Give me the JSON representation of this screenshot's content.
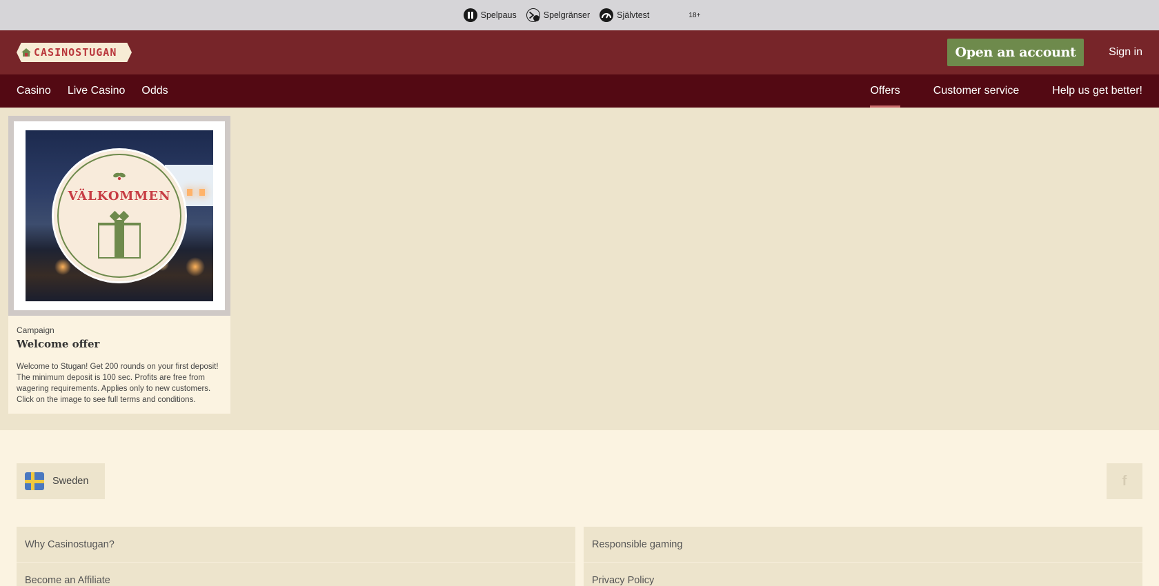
{
  "rg_bar": {
    "items": [
      {
        "label": "Spelpaus",
        "icon": "pause-icon"
      },
      {
        "label": "Spelgränser",
        "icon": "limit-gauge-icon"
      },
      {
        "label": "Självtest",
        "icon": "speedometer-icon"
      }
    ],
    "age": "18+"
  },
  "header": {
    "logo_text": "CASINOSTUGAN",
    "open_account": "Open an account",
    "sign_in": "Sign in"
  },
  "nav": {
    "left": [
      "Casino",
      "Live Casino",
      "Odds"
    ],
    "right": [
      "Offers",
      "Customer service",
      "Help us get better!"
    ],
    "active": "Offers"
  },
  "offer": {
    "badge_text": "VÄLKOMMEN",
    "tag": "Campaign",
    "title": "Welcome offer",
    "description": "Welcome to Stugan! Get 200 rounds on your first deposit! The minimum deposit is 100 sec. Profits are free from wagering requirements. Applies only to new customers. Click on the image to see full terms and conditions."
  },
  "footer": {
    "language": "Sweden",
    "facebook_glyph": "f",
    "links_left": [
      "Why Casinostugan?",
      "Become an Affiliate"
    ],
    "links_right": [
      "Responsible gaming",
      "Privacy Policy"
    ]
  },
  "colors": {
    "header_bg": "#772529",
    "nav_bg": "#530913",
    "cta_green": "#6e8a4c",
    "page_bg": "#ede4cc",
    "footer_bg": "#fbf3e1"
  }
}
